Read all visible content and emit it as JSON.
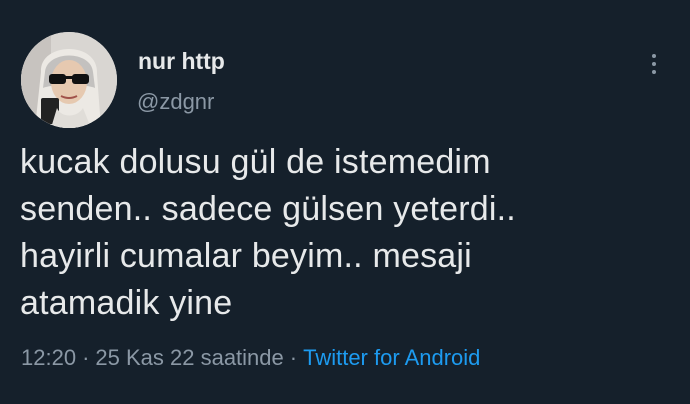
{
  "tweet": {
    "author": {
      "display_name": "nur http",
      "handle": "@zdgnr"
    },
    "text_lines": [
      "kucak dolusu gül de istemedim",
      "senden.. sadece gülsen yeterdi..",
      "hayirli cumalar beyim.. mesaji",
      "atamadik yine"
    ],
    "time": "12:20",
    "date": "25 Kas 22 saatinde",
    "separator": "·",
    "source": "Twitter for Android"
  },
  "colors": {
    "background": "#15202b",
    "primary_text": "#e7e9ea",
    "secondary_text": "#8b98a5",
    "link": "#1d9bf0"
  },
  "icons": {
    "more": "more-vertical-icon"
  }
}
